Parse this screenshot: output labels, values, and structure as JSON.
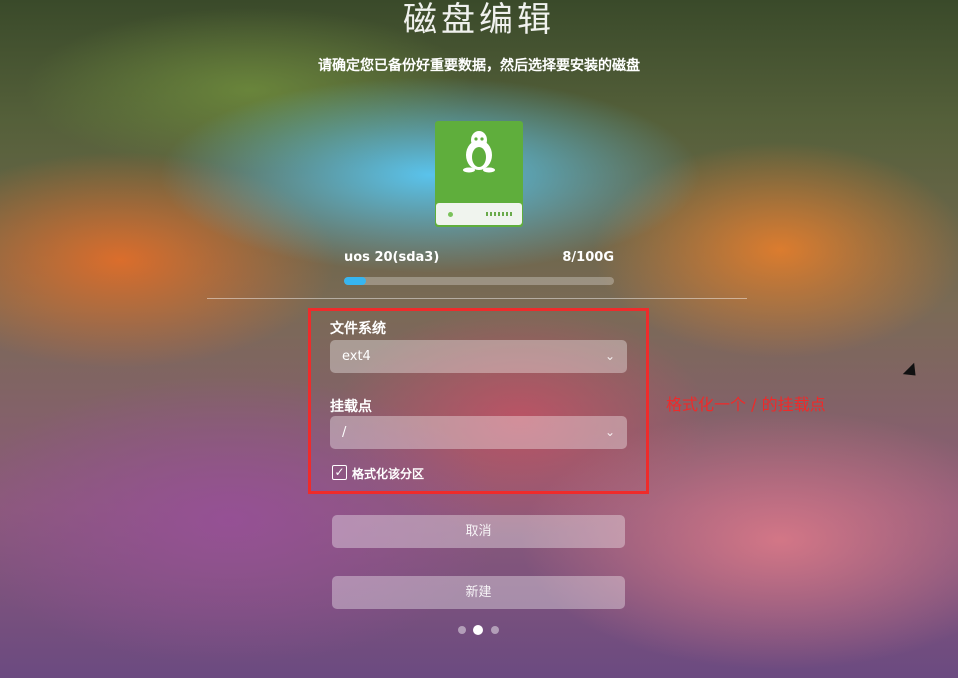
{
  "header": {
    "title": "磁盘编辑",
    "subtitle": "请确定您已备份好重要数据，然后选择要安装的磁盘"
  },
  "disk": {
    "icon": "linux-disk-icon",
    "name": "uos 20(sda3)",
    "size": "8/100G",
    "usage_fraction": 0.08
  },
  "form": {
    "filesystem_label": "文件系统",
    "filesystem_value": "ext4",
    "mountpoint_label": "挂载点",
    "mountpoint_value": "/",
    "format_checked": true,
    "format_label": "格式化该分区"
  },
  "annotation": "格式化一个 / 的挂载点",
  "buttons": {
    "cancel": "取消",
    "new": "新建"
  },
  "pagination": {
    "count": 3,
    "active": 1
  },
  "colors": {
    "accent": "#37b5f0",
    "annotation": "#ee2a2a",
    "disk_green": "#5fae3c"
  }
}
